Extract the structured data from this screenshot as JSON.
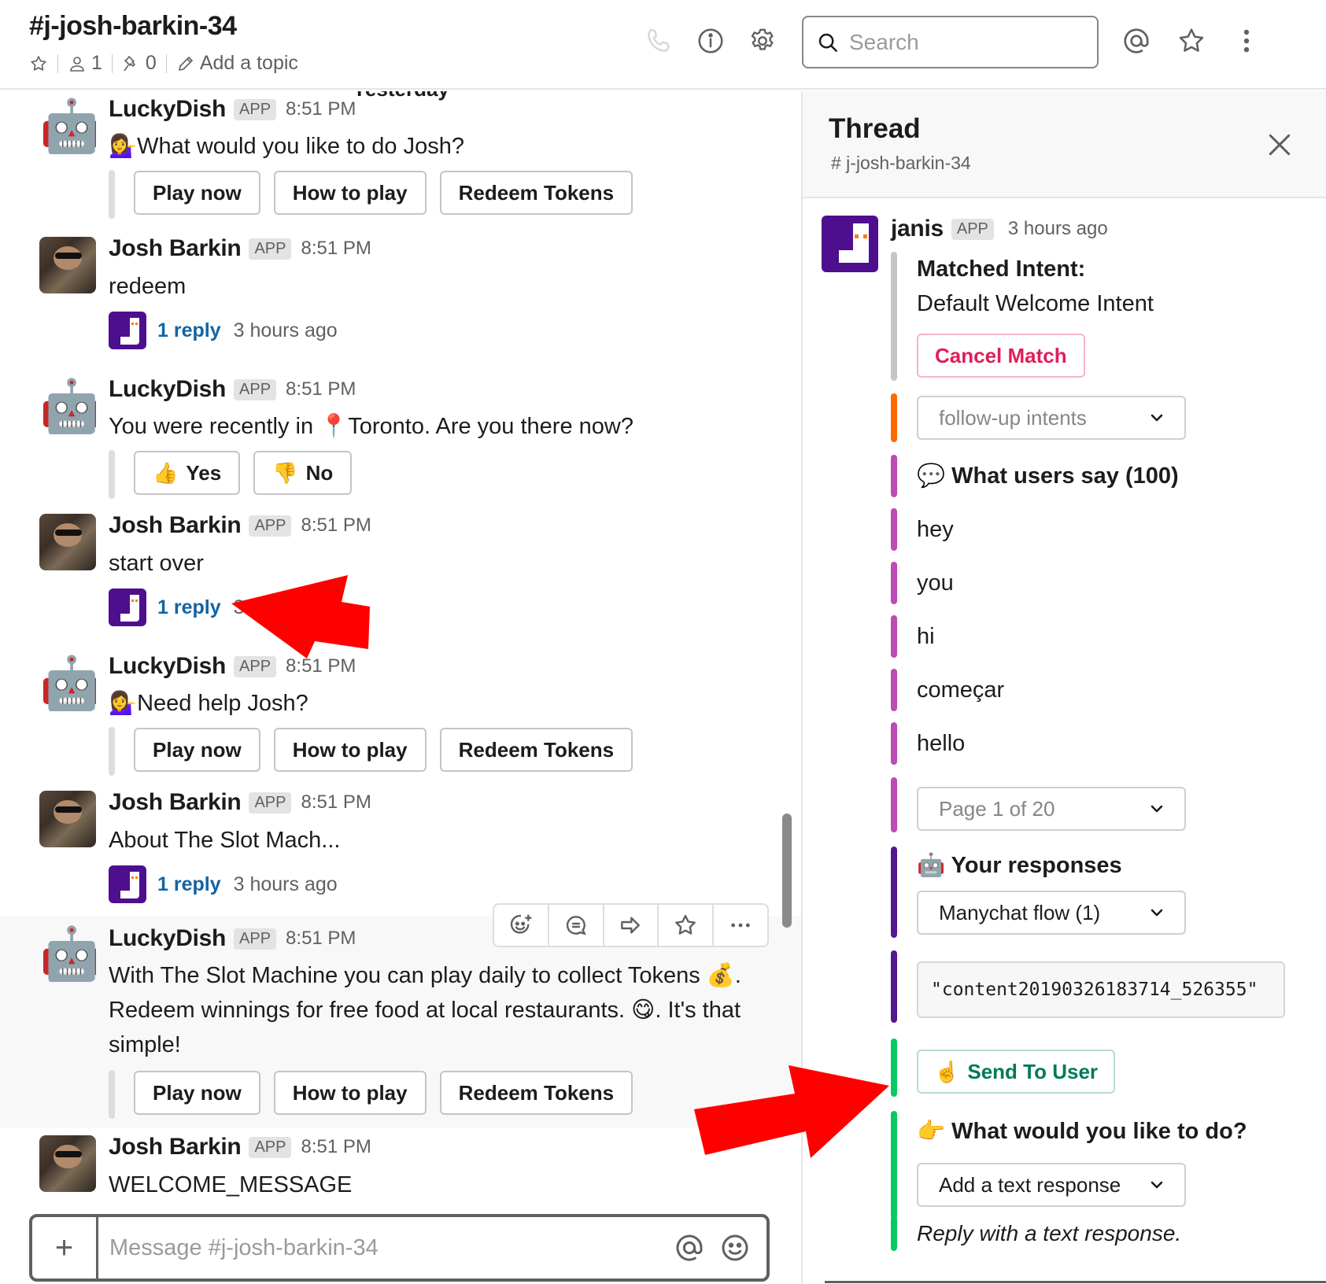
{
  "header": {
    "channel_name": "#j-josh-barkin-34",
    "member_count": "1",
    "pin_count": "0",
    "add_topic": "Add a topic",
    "search_placeholder": "Search",
    "icons": [
      "star-icon",
      "member-icon",
      "pin-icon",
      "pencil-icon",
      "phone-icon",
      "info-icon",
      "gear-icon",
      "search-icon",
      "at-icon",
      "star-icon",
      "more-vertical-icon"
    ]
  },
  "messages": {
    "day_divider": "Yesterday",
    "app_badge": "APP",
    "list": [
      {
        "sender": "LuckyDish",
        "avatar": "robot",
        "time": "8:51 PM",
        "emoji": "💁‍♀️",
        "text": "What would you like to do Josh?",
        "buttons": [
          "Play now",
          "How to play",
          "Redeem Tokens"
        ]
      },
      {
        "sender": "Josh Barkin",
        "avatar": "photo",
        "time": "8:51 PM",
        "text": "redeem",
        "reply": {
          "count": "1 reply",
          "time": "3 hours ago"
        }
      },
      {
        "sender": "LuckyDish",
        "avatar": "robot",
        "time": "8:51 PM",
        "text_before": "You were recently in ",
        "emoji": "📍",
        "text_after": "Toronto. Are you there now?",
        "buttons": [
          {
            "emoji": "👍",
            "label": "Yes"
          },
          {
            "emoji": "👎",
            "label": "No"
          }
        ]
      },
      {
        "sender": "Josh Barkin",
        "avatar": "photo",
        "time": "8:51 PM",
        "text": "start over",
        "reply": {
          "count": "1 reply",
          "time": "3 hours ago"
        }
      },
      {
        "sender": "LuckyDish",
        "avatar": "robot",
        "time": "8:51 PM",
        "emoji": "💁‍♀️",
        "text": "Need help Josh?",
        "buttons": [
          "Play now",
          "How to play",
          "Redeem Tokens"
        ]
      },
      {
        "sender": "Josh Barkin",
        "avatar": "photo",
        "time": "8:51 PM",
        "text": "About The Slot Mach...",
        "reply": {
          "count": "1 reply",
          "time": "3 hours ago"
        }
      },
      {
        "sender": "LuckyDish",
        "avatar": "robot",
        "time": "8:51 PM",
        "line1": "With The Slot Machine you can play daily to collect Tokens 💰.",
        "line2": "Redeem winnings for free food at local restaurants. 😋. It's that",
        "line3": "simple!",
        "buttons": [
          "Play now",
          "How to play",
          "Redeem Tokens"
        ]
      },
      {
        "sender": "Josh Barkin",
        "avatar": "photo",
        "time": "8:51 PM",
        "text": "WELCOME_MESSAGE"
      }
    ],
    "hover_actions": [
      "add-reaction-icon",
      "start-thread-icon",
      "share-icon",
      "star-icon",
      "more-horizontal-icon"
    ]
  },
  "composer": {
    "placeholder": "Message #j-josh-barkin-34",
    "plus": "+"
  },
  "thread": {
    "title": "Thread",
    "channel": "# j-josh-barkin-34",
    "sender": "janis",
    "badge": "APP",
    "time": "3 hours ago",
    "matched_intent_label": "Matched Intent:",
    "matched_intent_value": "Default Welcome Intent",
    "cancel_match": "Cancel Match",
    "followup_placeholder": "follow-up intents",
    "users_say_emoji": "💬",
    "users_say_title": "What users say (100)",
    "utterances": [
      "hey",
      "you",
      "hi",
      "começar",
      "hello"
    ],
    "page_select": "Page 1 of 20",
    "responses_emoji": "🤖",
    "responses_title": "Your responses",
    "response_select": "Manychat flow (1)",
    "content_id": "\"content20190326183714_526355\"",
    "send_emoji": "☝️",
    "send_label": "Send To User",
    "todo_emoji": "👉",
    "todo_title": "What would you like to do?",
    "action_select": "Add a text response",
    "hint": "Reply with a text response.",
    "colors": {
      "intent_bar": "#c5c5c5",
      "followup_bar": "#ff6a00",
      "users_say_bar": "#bf49b6",
      "responses_bar": "#521991",
      "send_bar": "#0ac864",
      "cancel_text": "#e01e5a",
      "send_text": "#007a5a",
      "reply_link": "#1264a3",
      "janis_brand": "#4e0f8e"
    }
  }
}
